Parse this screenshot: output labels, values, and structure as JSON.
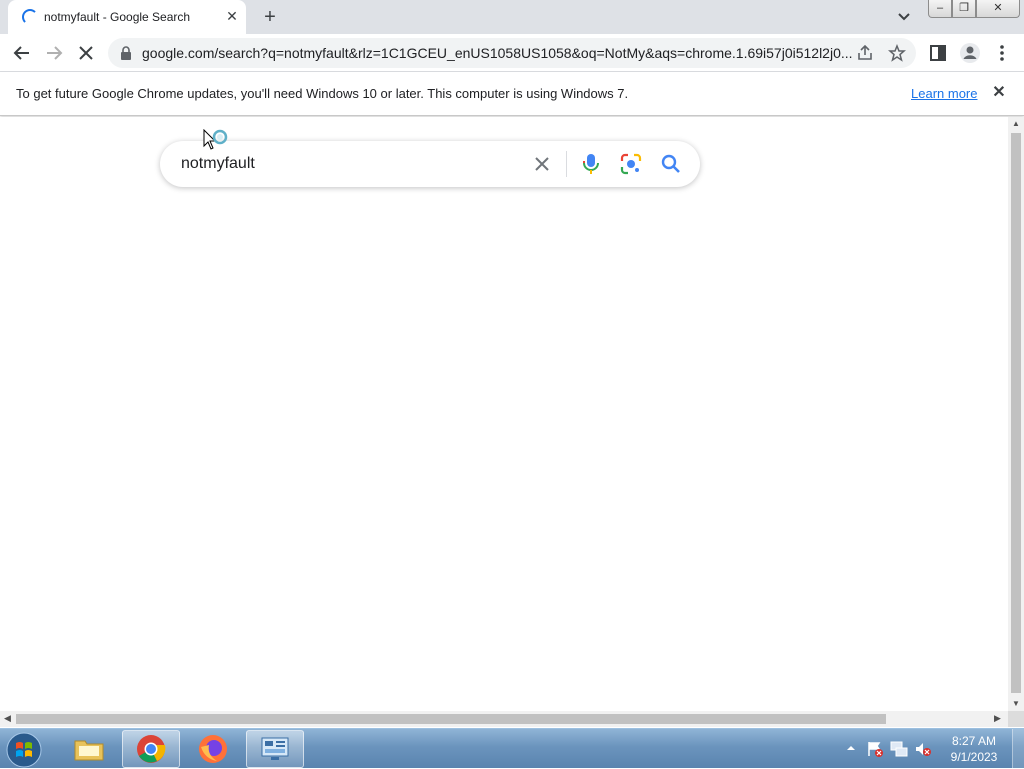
{
  "browser": {
    "tab": {
      "title": "notmyfault - Google Search",
      "close_label": "✕",
      "loading": true
    },
    "new_tab_label": "+",
    "window_controls": {
      "minimize_label": "–",
      "maximize_label": "❐",
      "close_label": "✕"
    },
    "omnibox": {
      "url": "google.com/search?q=notmyfault&rlz=1C1GCEU_enUS1058US1058&oq=NotMy&aqs=chrome.1.69i57j0i512l2j0..."
    },
    "infobar": {
      "message": "To get future Google Chrome updates, you'll need Windows 10 or later. This computer is using Windows 7.",
      "link_label": "Learn more",
      "close_label": "✕"
    }
  },
  "page": {
    "search": {
      "query": "notmyfault"
    }
  },
  "taskbar": {
    "clock": {
      "time": "8:27 AM",
      "date": "9/1/2023"
    }
  },
  "colors": {
    "accent": "#1a73e8",
    "tabstrip": "#dee1e6",
    "taskbar": "#6b94bd"
  },
  "icons": [
    "back-icon",
    "forward-icon",
    "stop-icon",
    "lock-icon",
    "share-icon",
    "star-icon",
    "side-panel-icon",
    "profile-icon",
    "menu-icon",
    "mic-icon",
    "lens-icon",
    "search-icon",
    "clear-icon"
  ]
}
